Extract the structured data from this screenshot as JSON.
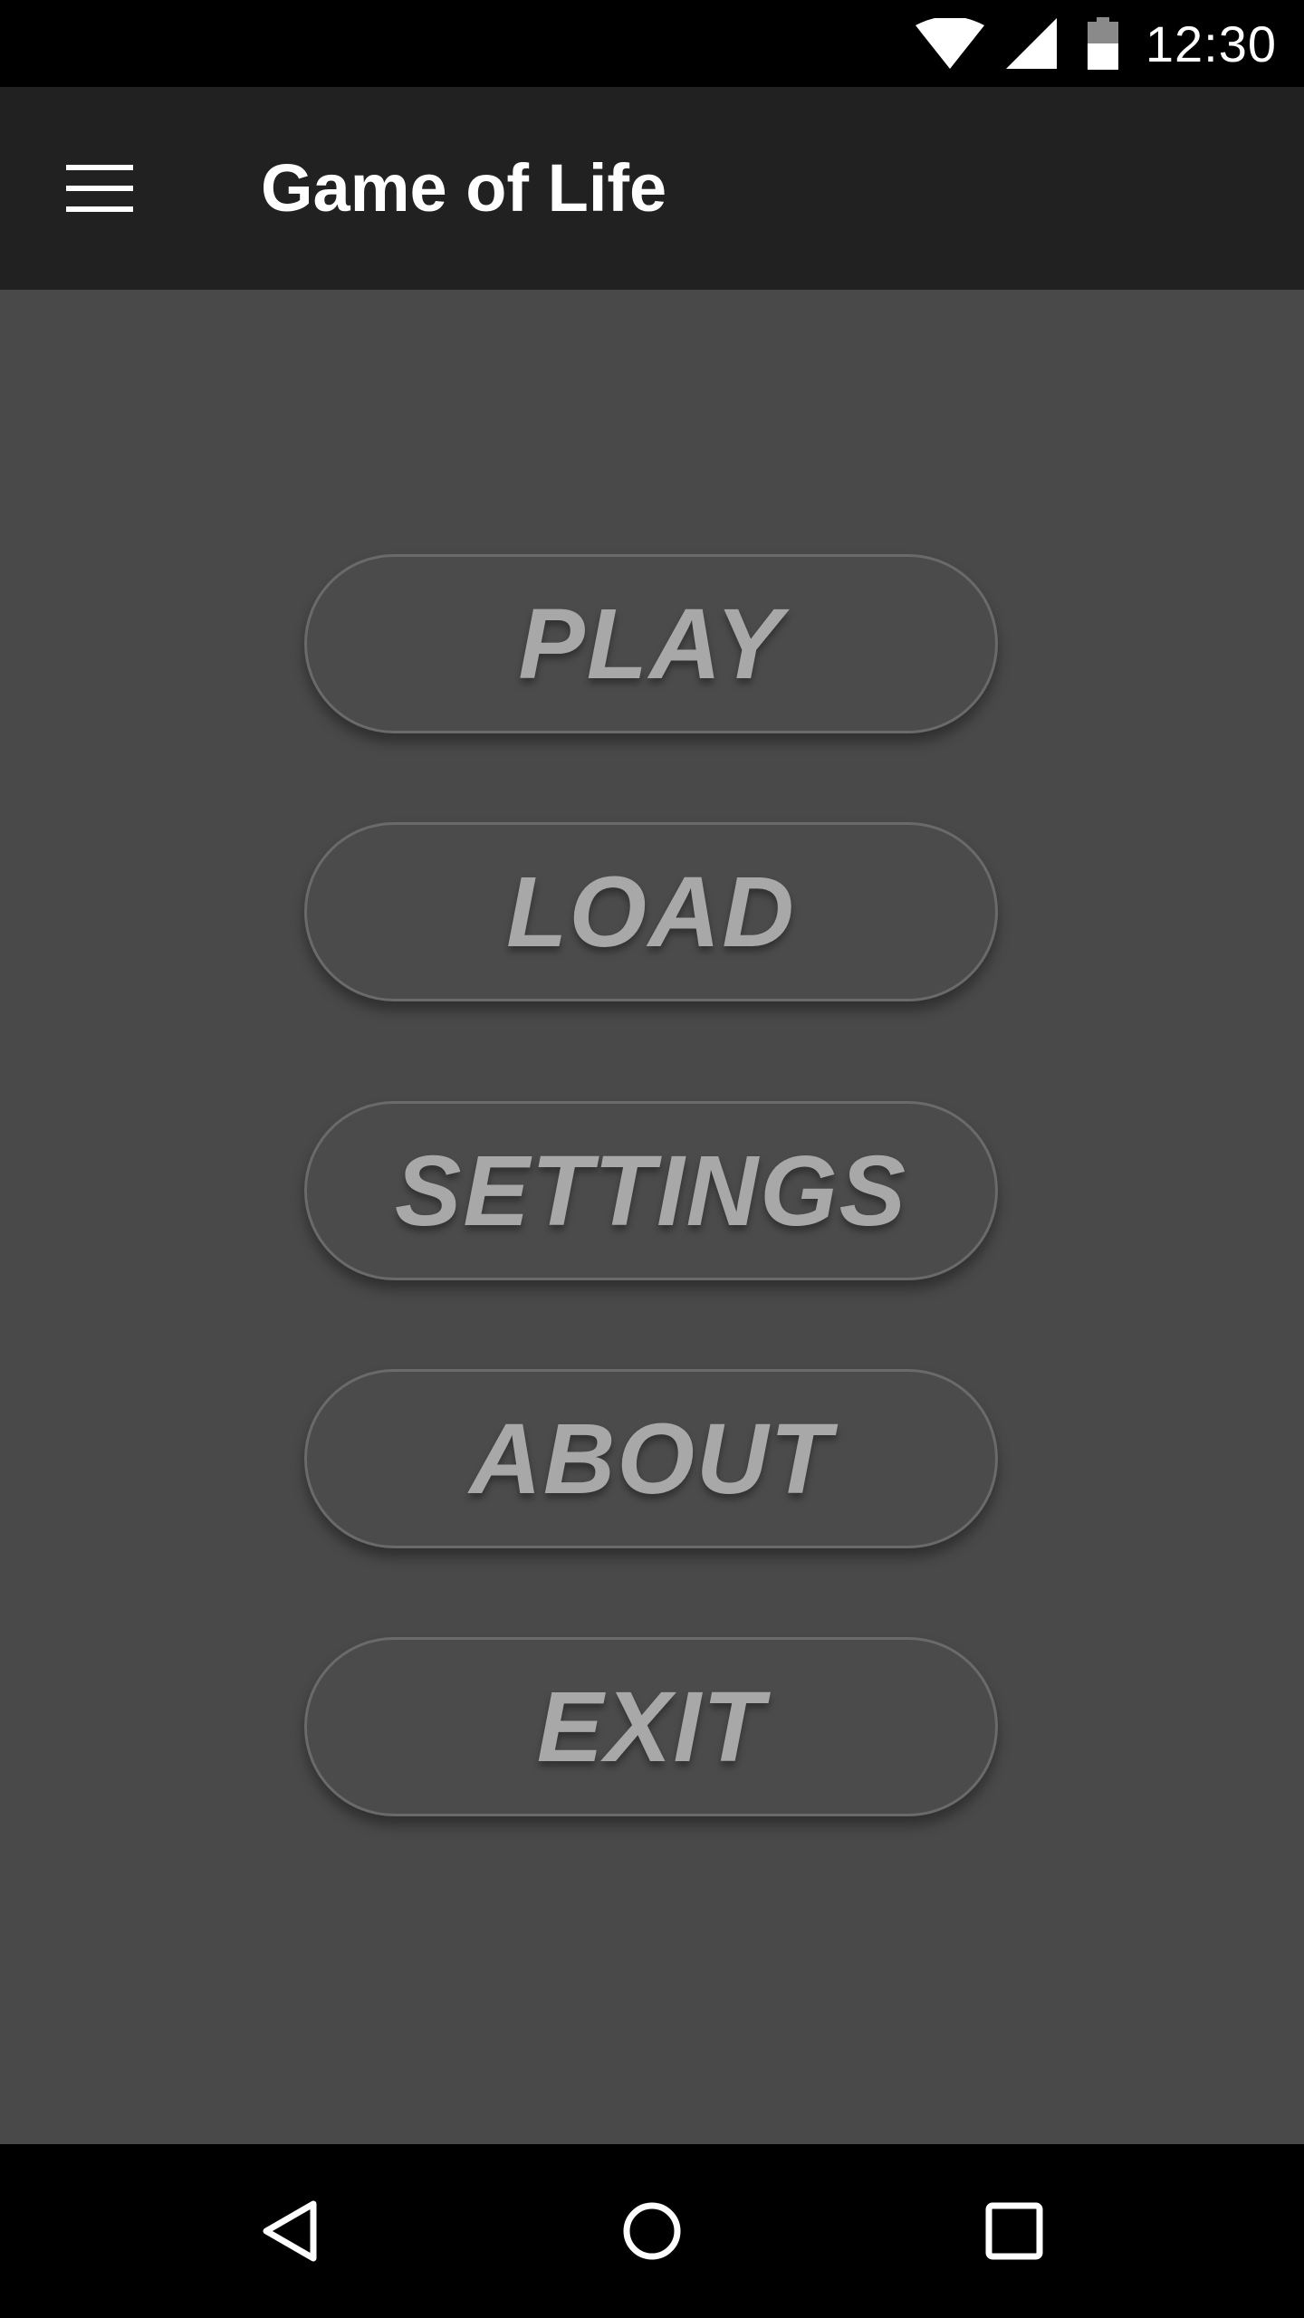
{
  "status_bar": {
    "time": "12:30",
    "icons": [
      "wifi-icon",
      "cell-signal-icon",
      "battery-icon"
    ]
  },
  "app_bar": {
    "title": "Game of Life",
    "menu_icon": "hamburger-menu-icon"
  },
  "menu": {
    "buttons": [
      {
        "label": "PLAY"
      },
      {
        "label": "LOAD"
      },
      {
        "label": "SETTINGS"
      },
      {
        "label": "ABOUT"
      },
      {
        "label": "EXIT"
      }
    ]
  },
  "nav_bar": {
    "icons": [
      "back-icon",
      "home-icon",
      "recents-icon"
    ]
  },
  "colors": {
    "status_bar_bg": "#000000",
    "app_bar_bg": "#212121",
    "content_bg": "#494949",
    "button_text": "#a8a8a8",
    "button_border": "#6a6a6a",
    "nav_bar_bg": "#000000"
  }
}
